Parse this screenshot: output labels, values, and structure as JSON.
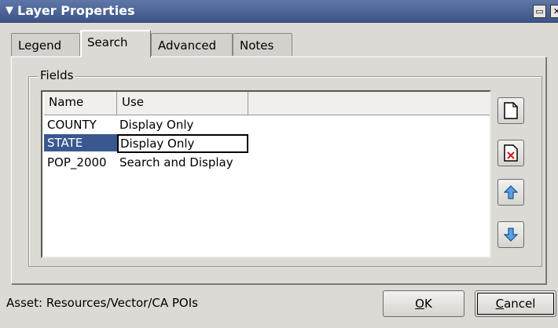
{
  "window": {
    "title": "Layer Properties",
    "icons": {
      "menu": "chevron-down-icon",
      "maximize": "maximize-icon",
      "close": "close-icon"
    }
  },
  "tabs": [
    {
      "label": "Legend",
      "active": false
    },
    {
      "label": "Search",
      "active": true
    },
    {
      "label": "Advanced",
      "active": false
    },
    {
      "label": "Notes",
      "active": false
    }
  ],
  "fields": {
    "legend": "Fields",
    "columns": [
      "Name",
      "Use"
    ],
    "rows": [
      {
        "name": "COUNTY",
        "use": "Display Only"
      },
      {
        "name": "STATE",
        "use": "Display Only",
        "selected": true,
        "editing": true
      },
      {
        "name": "POP_2000",
        "use": "Search and Display"
      }
    ],
    "buttons": [
      {
        "icon": "new-document-icon"
      },
      {
        "icon": "delete-document-icon"
      },
      {
        "icon": "move-up-icon"
      },
      {
        "icon": "move-down-icon"
      }
    ]
  },
  "footer": {
    "asset_label": "Asset:",
    "asset_path": "Resources/Vector/CA POIs",
    "ok_label": "OK",
    "ok_mnemonic": "O",
    "ok_rest": "K",
    "cancel_label": "Cancel",
    "cancel_mnemonic": "C",
    "cancel_rest": "ancel"
  },
  "colors": {
    "titlebar": "#3c5487",
    "selection": "#3a5790",
    "dialog_bg": "#dcdad5"
  }
}
